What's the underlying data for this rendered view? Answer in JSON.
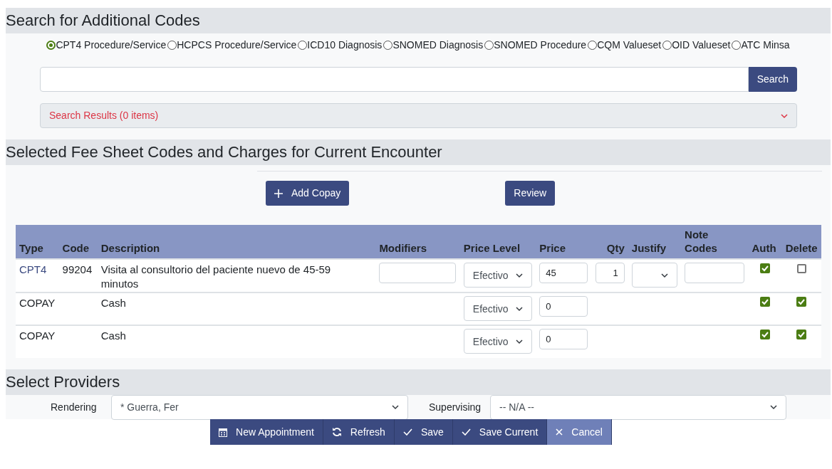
{
  "search_section": {
    "title": "Search for Additional Codes",
    "code_types": [
      {
        "label": "CPT4 Procedure/Service",
        "selected": true
      },
      {
        "label": "HCPCS Procedure/Service",
        "selected": false
      },
      {
        "label": "ICD10 Diagnosis",
        "selected": false
      },
      {
        "label": "SNOMED Diagnosis",
        "selected": false
      },
      {
        "label": "SNOMED Procedure",
        "selected": false
      },
      {
        "label": "CQM Valueset",
        "selected": false
      },
      {
        "label": "OID Valueset",
        "selected": false
      },
      {
        "label": "ATC Minsa",
        "selected": false
      }
    ],
    "search_button": "Search",
    "results": "Search Results (0 items)"
  },
  "fee_section": {
    "title": "Selected Fee Sheet Codes and Charges for Current Encounter",
    "add_copay_button": "Add Copay",
    "review_button": "Review",
    "table": {
      "columns": [
        "Type",
        "Code",
        "Description",
        "Modifiers",
        "Price Level",
        "Price",
        "Qty",
        "Justify",
        "Note Codes",
        "Auth",
        "Delete"
      ],
      "rows": [
        {
          "kind": "service",
          "type": "CPT4",
          "code": "99204",
          "description": "Visita al consultorio del paciente nuevo de 45-59 minutos",
          "price_level": "Efectivo",
          "price": "45",
          "qty": "1",
          "auth": true,
          "delete": false
        },
        {
          "kind": "copay",
          "type": "COPAY",
          "description": "Cash",
          "price_level": "Efectivo",
          "price": "0",
          "auth": true,
          "delete": true
        },
        {
          "kind": "copay",
          "type": "COPAY",
          "description": "Cash",
          "price_level": "Efectivo",
          "price": "0",
          "auth": true,
          "delete": true
        }
      ]
    }
  },
  "providers_section": {
    "title": "Select Providers",
    "rendering_label": "Rendering",
    "rendering_value": "* Guerra, Fer",
    "supervising_label": "Supervising",
    "supervising_value": "-- N/A --"
  },
  "actions": [
    {
      "kind": "appointment",
      "label": "New Appointment"
    },
    {
      "kind": "refresh",
      "label": "Refresh"
    },
    {
      "kind": "save",
      "label": "Save"
    },
    {
      "kind": "save",
      "label": "Save Current"
    },
    {
      "kind": "cancel",
      "label": "Cancel"
    }
  ]
}
